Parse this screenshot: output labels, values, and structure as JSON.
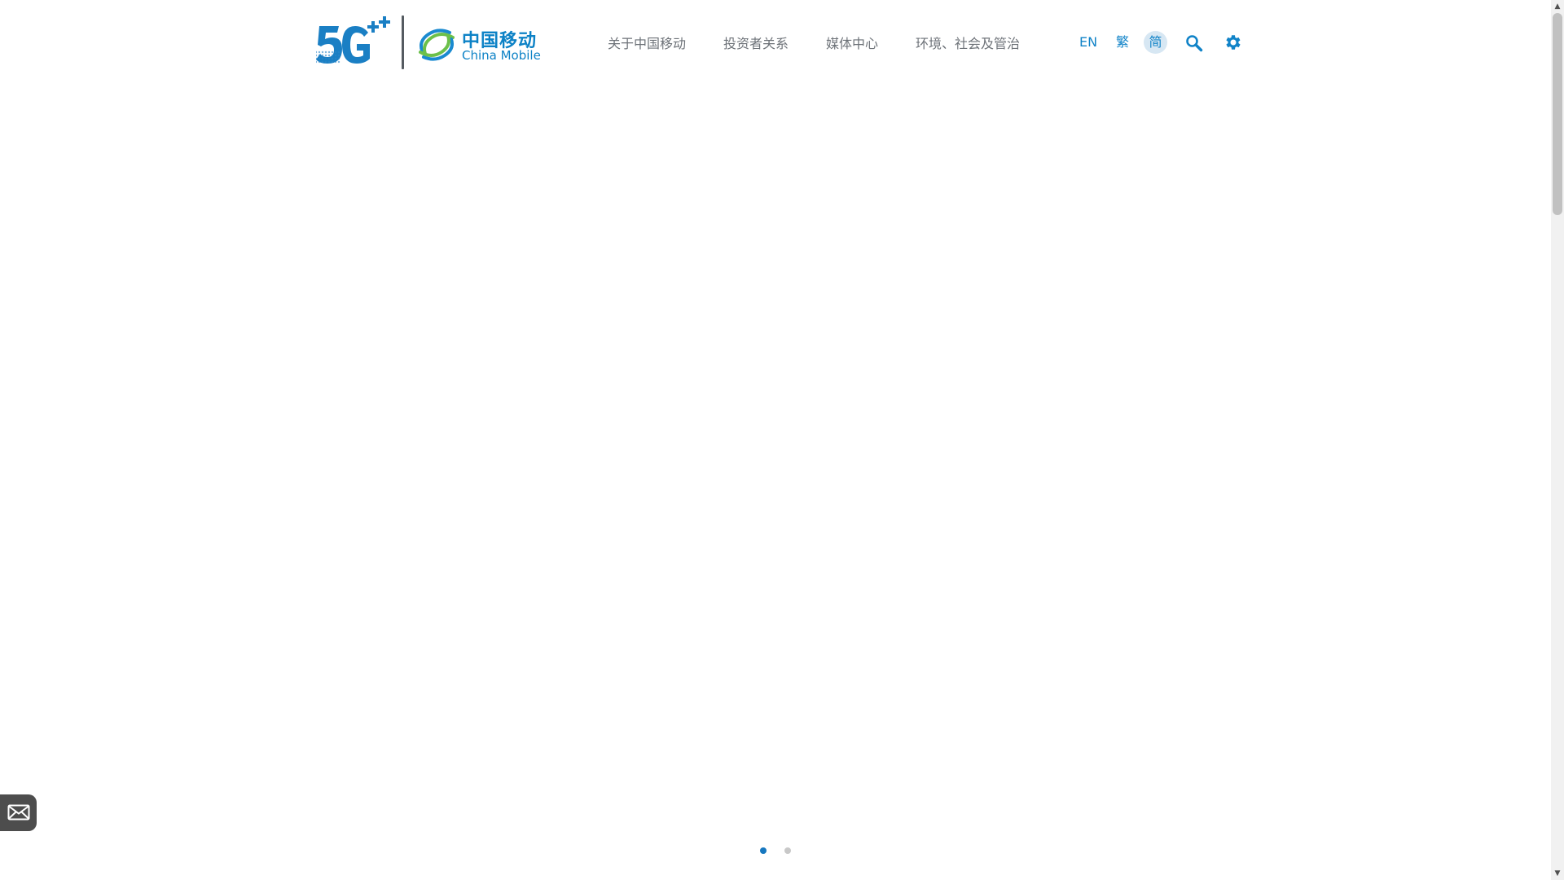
{
  "header": {
    "logo_5g_text": "5G++",
    "logo_cn": "中国移动",
    "logo_en": "China Mobile",
    "nav": [
      {
        "label": "关于中国移动"
      },
      {
        "label": "投资者关系"
      },
      {
        "label": "媒体中心"
      },
      {
        "label": "环境、社会及管治"
      }
    ],
    "lang": {
      "en": "EN",
      "tc": "繁",
      "sc": "简",
      "active": "简"
    },
    "icons": [
      "search-icon",
      "gear-icon"
    ]
  },
  "banner": {
    "slides_count": 2,
    "active_slide": 1
  },
  "floating": {
    "icon": "mail-icon"
  },
  "colors": {
    "brand_blue": "#1083c8",
    "nav_text": "#6d7278",
    "active_lang_bg": "#d7e7f3",
    "dot_active": "#1677bf",
    "dot_inactive": "#c8c8c8",
    "mail_button_bg": "#4d4d4d"
  }
}
